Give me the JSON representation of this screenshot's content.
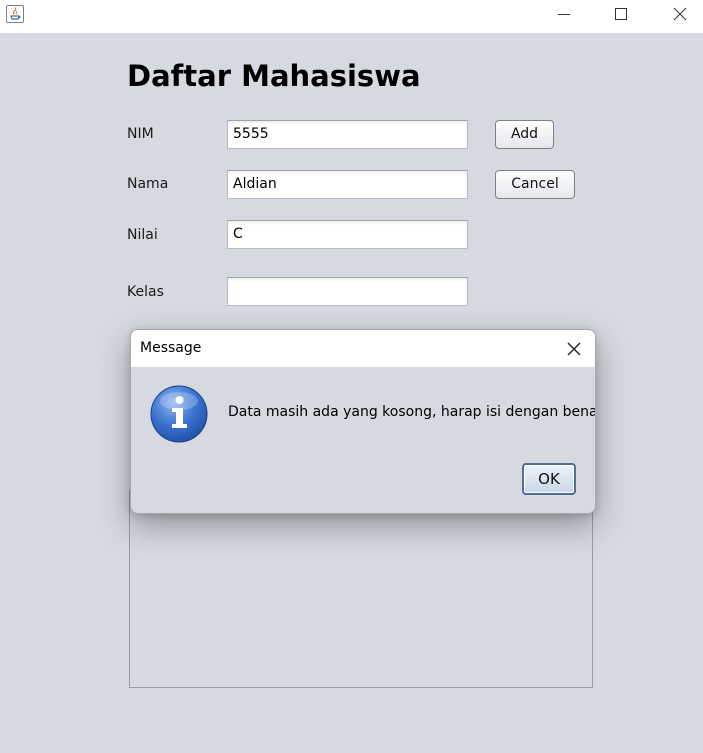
{
  "window": {
    "buttons": [
      "minimize",
      "maximize",
      "close"
    ]
  },
  "form": {
    "heading": "Daftar Mahasiswa",
    "fields": [
      {
        "label": "NIM",
        "value": "5555"
      },
      {
        "label": "Nama",
        "value": "Aldian"
      },
      {
        "label": "Nilai",
        "value": "C"
      },
      {
        "label": "Kelas",
        "value": ""
      }
    ],
    "add_label": "Add",
    "cancel_label": "Cancel"
  },
  "dialog": {
    "title": "Message",
    "icon": "information-icon",
    "message": "Data masih ada yang kosong, harap isi dengan benar!",
    "ok_label": "OK"
  },
  "colors": {
    "background": "#d6d9e0",
    "info_icon": "#2f66c4"
  }
}
